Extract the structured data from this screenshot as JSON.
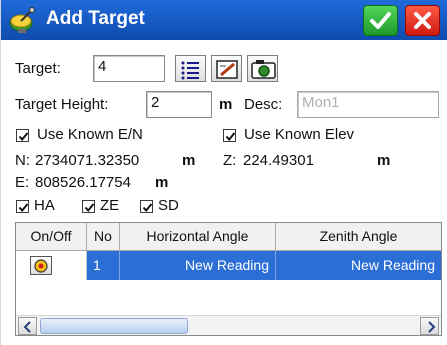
{
  "window": {
    "title": "Add Target",
    "icons": {
      "app": "satellite-dish-icon",
      "ok": "checkmark-icon",
      "close": "close-x-icon"
    },
    "colors": {
      "titlebar": "#1558c4",
      "ok": "#2db43d",
      "close": "#e32b1d",
      "selection": "#2b6fd6"
    }
  },
  "form": {
    "target_label": "Target:",
    "target_value": "4",
    "toolbar_icons": [
      "list-icon",
      "edit-icon",
      "camera-icon"
    ],
    "target_height_label": "Target Height:",
    "target_height_value": "2",
    "target_height_unit": "m",
    "desc_label": "Desc:",
    "desc_placeholder": "Mon1",
    "use_known_en": {
      "label": "Use Known E/N",
      "checked": true
    },
    "use_known_elev": {
      "label": "Use Known Elev",
      "checked": true
    },
    "n_label": "N:",
    "n_value": "2734071.32350",
    "n_unit": "m",
    "e_label": "E:",
    "e_value": "808526.17754",
    "e_unit": "m",
    "z_label": "Z:",
    "z_value": "224.49301",
    "z_unit": "m",
    "ha": {
      "label": "HA",
      "checked": true
    },
    "ze": {
      "label": "ZE",
      "checked": true
    },
    "sd": {
      "label": "SD",
      "checked": true
    }
  },
  "table": {
    "columns": [
      "On/Off",
      "No",
      "Horizontal Angle",
      "Zenith Angle"
    ],
    "rows": [
      {
        "on": true,
        "no": "1",
        "horizontal_angle": "New Reading",
        "zenith_angle": "New Reading",
        "selected": true
      }
    ]
  }
}
